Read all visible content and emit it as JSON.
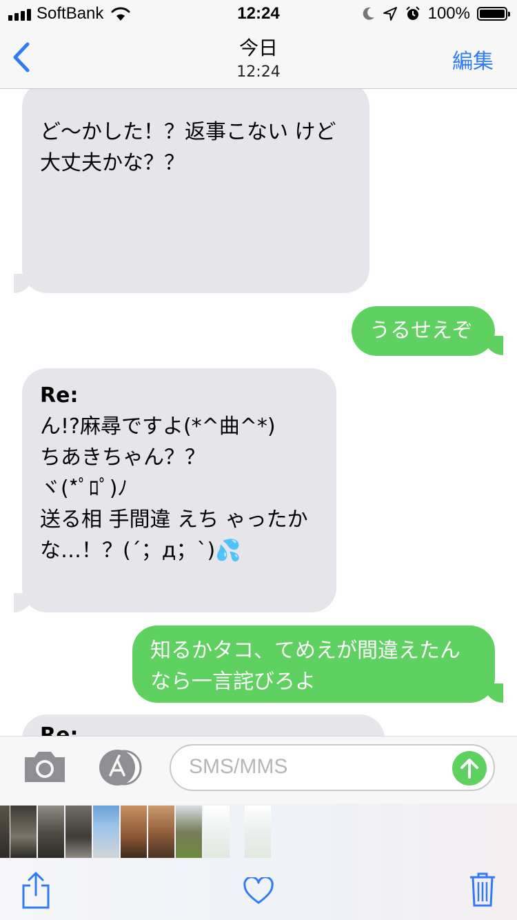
{
  "status_bar": {
    "carrier": "SoftBank",
    "time": "12:24",
    "battery": "100%"
  },
  "nav": {
    "title": "今日",
    "subtitle": "12:24",
    "edit_label": "編集"
  },
  "messages": [
    {
      "direction": "in",
      "header": "",
      "text": "ど〜かした！？返事こない けど\n大丈夫かな？？"
    },
    {
      "direction": "out",
      "header": "",
      "text": "うるせえぞ"
    },
    {
      "direction": "in",
      "header": "Re:",
      "text": "ん!?麻尋ですよ(*^曲^*)\nちあきちゃん？？\nヾ(*ﾟﾛﾟ)ﾉ\n送る相 手間違 えち ゃったか\nな…！？(´；д；`)💦"
    },
    {
      "direction": "out",
      "header": "",
      "text": "知るかタコ、てめえが間違えたん\nなら一言詫びろよ"
    },
    {
      "direction": "in",
      "header": "Re:",
      "text": ""
    }
  ],
  "input": {
    "placeholder": "SMS/MMS"
  },
  "colors": {
    "incoming_bubble": "#e5e5ea",
    "outgoing_bubble": "#5fd161",
    "accent": "#2f7bf5"
  },
  "icons": {
    "back": "chevron-left-icon",
    "camera": "camera-icon",
    "appstore": "app-store-icon",
    "send": "arrow-up-icon",
    "share": "share-icon",
    "favorite": "heart-icon",
    "delete": "trash-icon"
  }
}
